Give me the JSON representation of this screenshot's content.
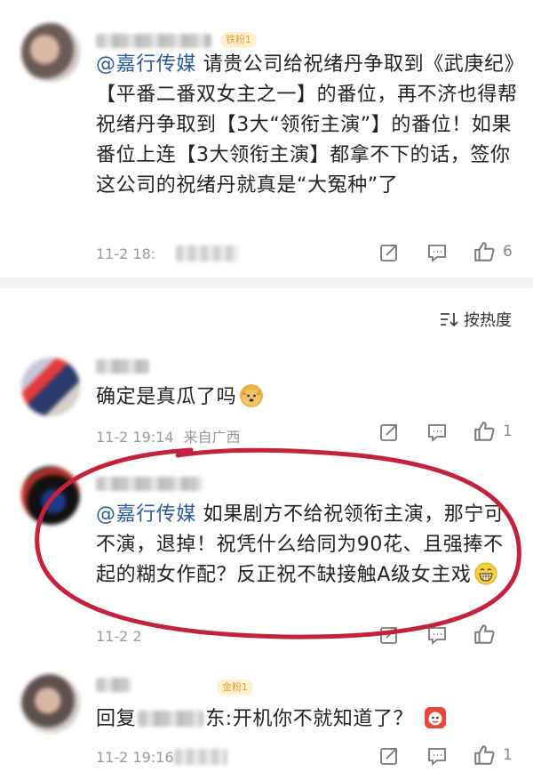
{
  "comments": [
    {
      "badge": "铁粉1",
      "mention": "@嘉行传媒",
      "text": " 请贵公司给祝绪丹争取到《武庚纪》【平番二番双女主之一】的番位，再不济也得帮祝绪丹争取到【3大“领衔主演”】的番位！如果番位上连【3大领衔主演】都拿不下的话，签你这公司的祝绪丹就真是“大冤种”了",
      "time": "11-2 18:",
      "likes": "6"
    },
    {
      "text": "确定是真瓜了吗",
      "emoji": "doge-emoji",
      "time": "11-2 19:14",
      "location": "来自广西",
      "likes": "1"
    },
    {
      "mention": "@嘉行传媒",
      "text": " 如果剧方不给祝领衔主演，那宁可不演，退掉！祝凭什么给同为90花、且强捧不起的糊女作配？反正祝不缺接触A级女主戏",
      "emoji": "grin-emoji",
      "time": "11-2 2",
      "likes": ""
    },
    {
      "badge": "金粉1",
      "reply_prefix": "回复",
      "reply_suffix": "东:开机你不就知道了？",
      "emoji": "red-face-emoji",
      "time": "11-2 19:16",
      "likes": "1"
    }
  ],
  "sort": {
    "label": "按热度",
    "icon": "sort-icon"
  },
  "colors": {
    "mention": "#2a5a9e",
    "circle": "#c4213a",
    "meta": "#999999"
  }
}
